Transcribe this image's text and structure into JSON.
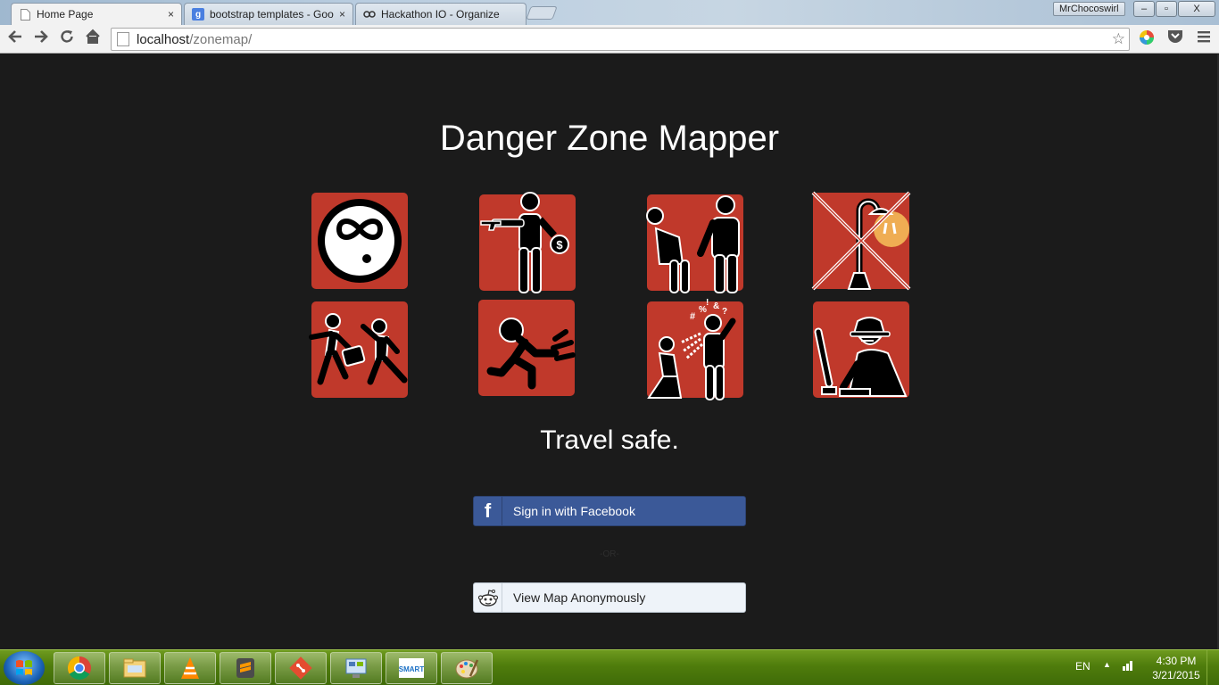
{
  "browser": {
    "tabs": [
      {
        "title": "Home Page",
        "active": true
      },
      {
        "title": "bootstrap templates - Goo",
        "active": false
      },
      {
        "title": "Hackathon IO - Organize",
        "active": false
      }
    ],
    "close_glyph": "×",
    "profile_name": "MrChocoswirl",
    "window_buttons": {
      "minimize": "–",
      "maximize": "▫",
      "close": "X"
    },
    "url_host": "localhost",
    "url_path": "/zonemap/"
  },
  "page": {
    "title": "Danger Zone Mapper",
    "tiles": [
      {
        "icon": "intoxicated-face-icon"
      },
      {
        "icon": "armed-robbery-icon"
      },
      {
        "icon": "harassment-icon"
      },
      {
        "icon": "no-streetlight-icon"
      },
      {
        "icon": "purse-snatching-icon"
      },
      {
        "icon": "running-person-icon"
      },
      {
        "icon": "verbal-abuse-icon"
      },
      {
        "icon": "cyber-criminal-icon"
      }
    ],
    "tagline": "Travel safe.",
    "facebook_button": "Sign in with Facebook",
    "facebook_glyph": "f",
    "or_text": "-OR-",
    "anonymous_button": "View Map Anonymously",
    "colors": {
      "tile": "#c0392b",
      "background": "#1b1b1b",
      "facebook": "#3b5998"
    }
  },
  "taskbar": {
    "apps": [
      "chrome-icon",
      "explorer-icon",
      "vlc-icon",
      "sublime-icon",
      "git-icon",
      "control-panel-icon",
      "smart-bro-icon",
      "paint-icon"
    ],
    "language": "EN",
    "time": "4:30 PM",
    "date": "3/21/2015"
  }
}
